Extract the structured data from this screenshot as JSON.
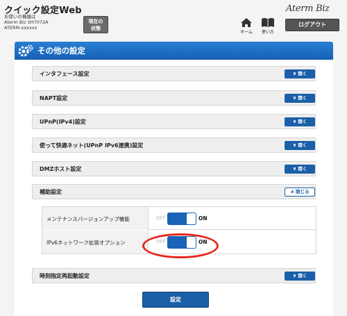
{
  "header": {
    "app_title": "クイック設定Web",
    "device_lines": [
      "お使いの機器は",
      "Aterm Biz SH7072A",
      "ATERM-xxxxxx"
    ],
    "status_button": [
      "現在の",
      "状態"
    ],
    "brand": "Aterm Biz",
    "home_label": "ホーム",
    "guide_label": "使い方",
    "logout_label": "ログアウト"
  },
  "section": {
    "title": "その他の設定"
  },
  "rows": [
    {
      "label": "インタフェース設定",
      "button": "開く"
    },
    {
      "label": "NAPT設定",
      "button": "開く"
    },
    {
      "label": "UPnP(IPv4)設定",
      "button": "開く"
    },
    {
      "label": "使って快適ネット(UPnP IPv6連携)設定",
      "button": "開く"
    },
    {
      "label": "DMZホスト設定",
      "button": "開く"
    },
    {
      "label": "補助設定",
      "button": "閉じる"
    },
    {
      "label": "時刻指定再起動設定",
      "button": "開く"
    }
  ],
  "details": [
    {
      "label": "メンテナンスバージョンアップ機能",
      "off": "OFF",
      "on": "ON",
      "value": "ON"
    },
    {
      "label": "IPv6ネットワーク拡張オプション",
      "off": "OFF",
      "on": "ON",
      "value": "ON"
    }
  ],
  "submit_label": "設定",
  "colors": {
    "accent": "#1a5fa8",
    "header_gradient": "#2a7fd2",
    "highlight": "#e8261a"
  }
}
